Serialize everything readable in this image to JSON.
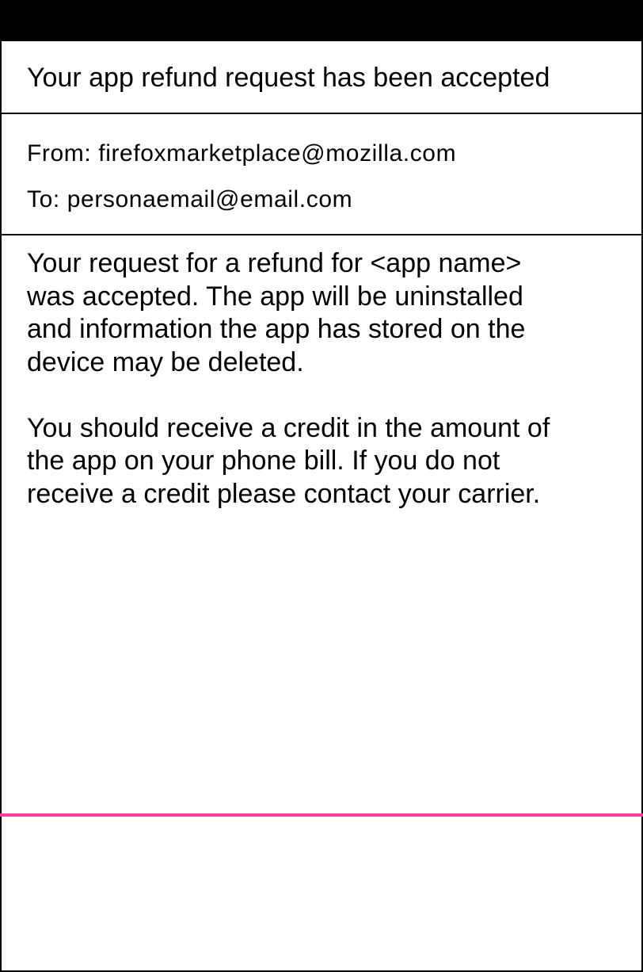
{
  "email": {
    "subject": "Your app refund request has been accepted",
    "from": "From: firefoxmarketplace@mozilla.com",
    "to": "To: personaemail@email.com",
    "body": {
      "paragraph_1": "Your request for a refund for <app name>\nwas accepted. The app will be uninstalled\nand information the app has stored on the\ndevice may be deleted.",
      "paragraph_2": "You should receive a credit in the amount of\nthe app on your phone bill. If you do not\nreceive a credit please contact your carrier."
    }
  },
  "colors": {
    "status_bar": "#000000",
    "divider_accent": "#ff3ea0",
    "text": "#000000",
    "background": "#ffffff"
  }
}
